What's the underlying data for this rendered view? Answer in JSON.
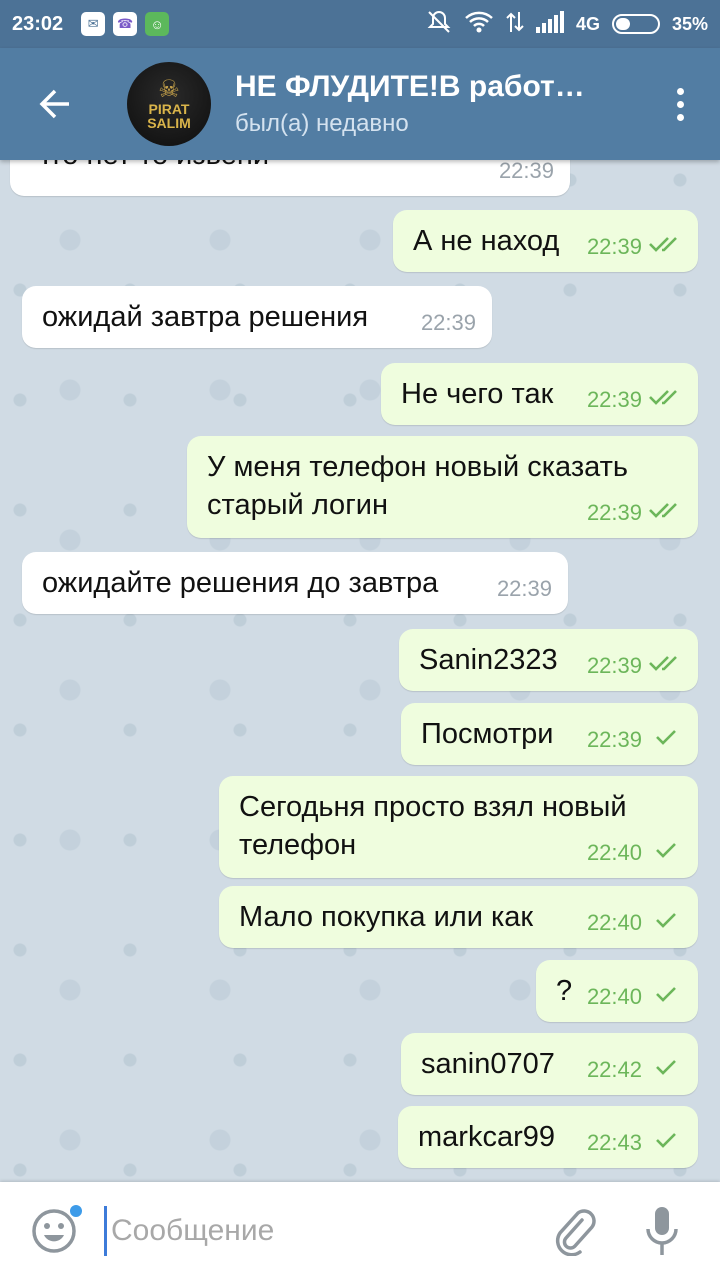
{
  "status": {
    "time": "23:02",
    "network": "4G",
    "battery": "35%",
    "battery_level": 0.35,
    "notification_icons": [
      "messages-icon",
      "viber-icon",
      "android-icon"
    ]
  },
  "header": {
    "title": "НЕ ФЛУДИТЕ!В работ…",
    "subtitle": "был(а) недавно",
    "avatar_text_1": "PIRAT",
    "avatar_text_2": "SALIM"
  },
  "messages": [
    {
      "dir": "in",
      "text": "Что нет то извени",
      "time": "22:39"
    },
    {
      "dir": "out",
      "text": "А не наход",
      "time": "22:39",
      "status": "read"
    },
    {
      "dir": "in",
      "text": "ожидай завтра решения",
      "time": "22:39"
    },
    {
      "dir": "out",
      "text": "Не чего так",
      "time": "22:39",
      "status": "read"
    },
    {
      "dir": "out",
      "text": "У меня телефон новый сказать старый логин",
      "time": "22:39",
      "status": "read"
    },
    {
      "dir": "in",
      "text": "ожидайте решения до завтра",
      "time": "22:39"
    },
    {
      "dir": "out",
      "text": "Sanin2323",
      "time": "22:39",
      "status": "read"
    },
    {
      "dir": "out",
      "text": "Посмотри",
      "time": "22:39",
      "status": "sent"
    },
    {
      "dir": "out",
      "text": "Сегодьня просто взял новый телефон",
      "time": "22:40",
      "status": "sent"
    },
    {
      "dir": "out",
      "text": "Мало покупка или как",
      "time": "22:40",
      "status": "sent"
    },
    {
      "dir": "out",
      "text": "?",
      "time": "22:40",
      "status": "sent"
    },
    {
      "dir": "out",
      "text": "sanin0707",
      "time": "22:42",
      "status": "sent"
    },
    {
      "dir": "out",
      "text": "markcar99",
      "time": "22:43",
      "status": "sent"
    }
  ],
  "composer": {
    "placeholder": "Сообщение"
  },
  "colors": {
    "header": "#527da3",
    "statusbar": "#4c7296",
    "outgoing_bubble": "#effdde",
    "incoming_bubble": "#ffffff",
    "check": "#6cb65a"
  }
}
